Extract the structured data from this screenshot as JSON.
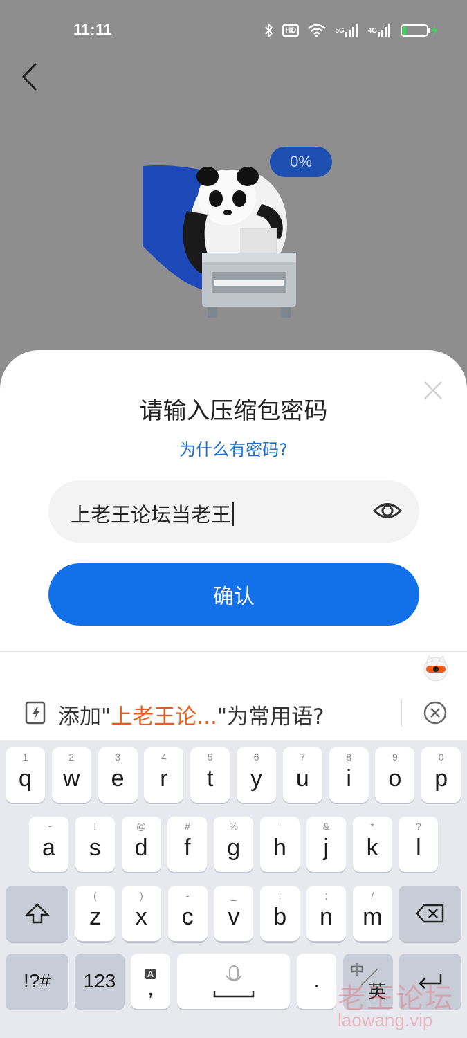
{
  "status_bar": {
    "time": "11:11",
    "hd_label": "HD",
    "net_5g": "5G",
    "net_4g": "4G",
    "battery_level": 0.15
  },
  "progress": {
    "label": "0%"
  },
  "dialog": {
    "title": "请输入压缩包密码",
    "why_link": "为什么有密码?",
    "password_value": "上老王论坛当老王",
    "confirm_label": "确认"
  },
  "suggestion": {
    "prefix": "添加\"",
    "highlight": "上老王论...",
    "suffix": "\"为常用语?"
  },
  "keyboard": {
    "row1": [
      {
        "main": "q",
        "sub": "1"
      },
      {
        "main": "w",
        "sub": "2"
      },
      {
        "main": "e",
        "sub": "3"
      },
      {
        "main": "r",
        "sub": "4"
      },
      {
        "main": "t",
        "sub": "5"
      },
      {
        "main": "y",
        "sub": "6"
      },
      {
        "main": "u",
        "sub": "7"
      },
      {
        "main": "i",
        "sub": "8"
      },
      {
        "main": "o",
        "sub": "9"
      },
      {
        "main": "p",
        "sub": "0"
      }
    ],
    "row2": [
      {
        "main": "a",
        "sub": "~"
      },
      {
        "main": "s",
        "sub": "!"
      },
      {
        "main": "d",
        "sub": "@"
      },
      {
        "main": "f",
        "sub": "#"
      },
      {
        "main": "g",
        "sub": "%"
      },
      {
        "main": "h",
        "sub": "'"
      },
      {
        "main": "j",
        "sub": "&"
      },
      {
        "main": "k",
        "sub": "*"
      },
      {
        "main": "l",
        "sub": "?"
      }
    ],
    "row3": [
      {
        "main": "z",
        "sub": "("
      },
      {
        "main": "x",
        "sub": ")"
      },
      {
        "main": "c",
        "sub": "-"
      },
      {
        "main": "v",
        "sub": "_"
      },
      {
        "main": "b",
        "sub": ":"
      },
      {
        "main": "n",
        "sub": ";"
      },
      {
        "main": "m",
        "sub": "/"
      }
    ],
    "symbols_label": "!?#",
    "numbers_label": "123",
    "punct_main": ",",
    "punct_badge": "A",
    "period_label": ".",
    "lang_top": "中",
    "lang_bottom": "英"
  },
  "watermark": {
    "cn": "老王论坛",
    "en": "laowang.vip"
  },
  "icons": {
    "back": "chevron-left-icon",
    "close": "close-icon",
    "eye": "eye-icon",
    "mic": "mic-icon",
    "shift": "shift-icon",
    "backspace": "backspace-icon",
    "enter": "enter-icon"
  },
  "colors": {
    "accent": "#1270e9",
    "link": "#1d6fd1",
    "highlight": "#ef5a1a",
    "overlay": "#8e8e8e"
  }
}
